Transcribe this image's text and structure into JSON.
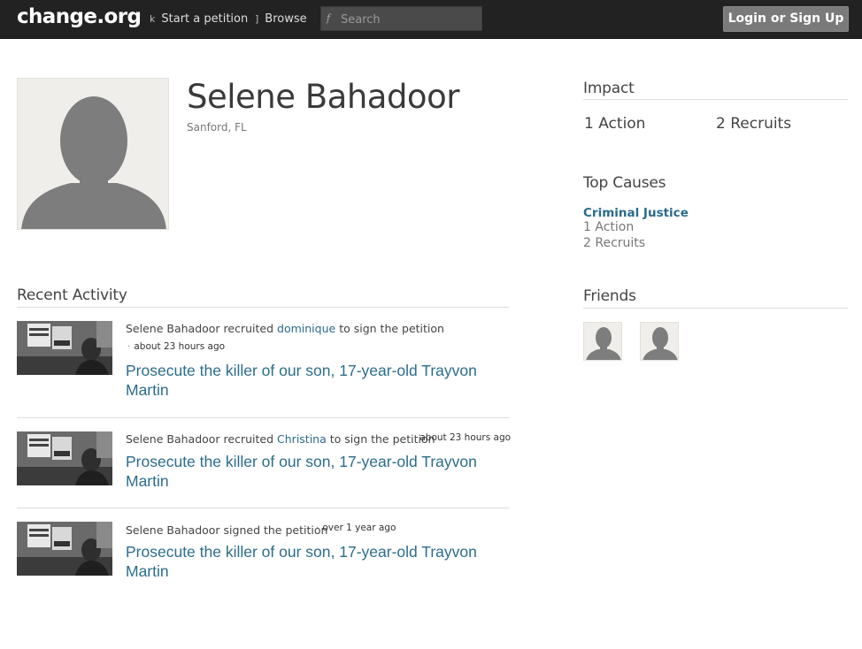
{
  "header": {
    "logo": "change.org",
    "nav": [
      {
        "label": "Start a petition",
        "icon": "k"
      },
      {
        "label": "Browse",
        "icon": "]"
      }
    ],
    "search": {
      "placeholder": "Search",
      "icon": "f"
    },
    "login_label": "Login or Sign Up"
  },
  "profile": {
    "name": "Selene Bahadoor",
    "location": "Sanford, FL"
  },
  "activity": {
    "title": "Recent Activity",
    "items": [
      {
        "actor": "Selene Bahadoor",
        "verb": "recruited",
        "target": "dominique",
        "suffix": "to sign the petition",
        "time": "about 23 hours ago",
        "petition": "Prosecute the killer of our son, 17-year-old Trayvon Martin"
      },
      {
        "actor": "Selene Bahadoor",
        "verb": "recruited",
        "target": "Christina",
        "suffix": "to sign the petition",
        "time": "about 23 hours ago",
        "petition": "Prosecute the killer of our son, 17-year-old Trayvon Martin"
      },
      {
        "actor": "Selene Bahadoor",
        "verb": "signed the petition",
        "time": "over 1 year ago",
        "petition": "Prosecute the killer of our son, 17-year-old Trayvon Martin"
      }
    ]
  },
  "sidebar": {
    "impact_title": "Impact",
    "actions": "1 Action",
    "recruits": "2 Recruits",
    "top_causes_title": "Top Causes",
    "causes": [
      {
        "name": "Criminal Justice",
        "actions": "1 Action",
        "recruits": "2 Recruits"
      }
    ],
    "friends_title": "Friends",
    "friend_icons": [
      "default-avatar-icon",
      "default-avatar-icon"
    ]
  },
  "colors": {
    "topbar": "#222222",
    "link": "#2b6d8d",
    "login_button": "#7a7a7a"
  }
}
